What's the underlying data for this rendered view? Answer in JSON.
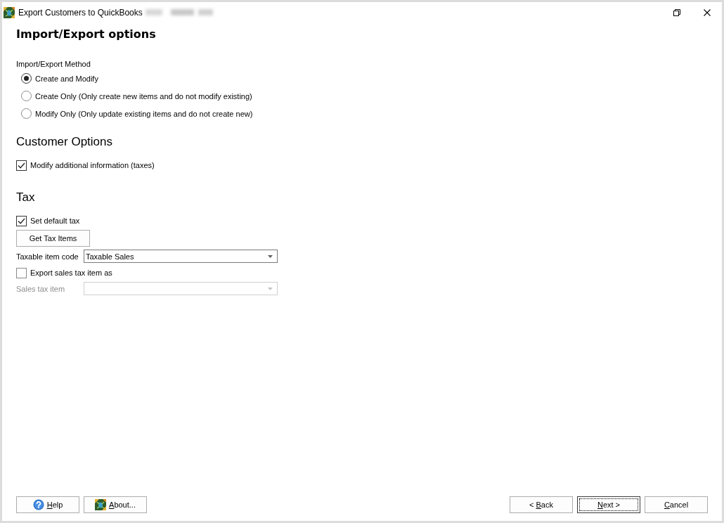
{
  "window": {
    "title": "Export Customers to QuickBooks"
  },
  "page_title": "Import/Export options",
  "method": {
    "label": "Import/Export Method",
    "options": [
      {
        "label": "Create and Modify",
        "selected": true
      },
      {
        "label": "Create Only (Only create new items and do not modify existing)",
        "selected": false
      },
      {
        "label": "Modify Only (Only update existing items and do not create new)",
        "selected": false
      }
    ]
  },
  "customer_options": {
    "heading": "Customer Options",
    "items": [
      {
        "label": "Modify additional information (taxes)",
        "checked": true
      }
    ]
  },
  "tax": {
    "heading": "Tax",
    "rows": [
      {
        "kind": "checkbox",
        "label": "Set default tax",
        "checked": true
      },
      {
        "kind": "button",
        "label": "Get Tax Items"
      },
      {
        "kind": "combo",
        "label": "Taxable item code",
        "value": "Taxable Sales",
        "disabled": false
      },
      {
        "kind": "checkbox",
        "label": "Export sales tax item as",
        "checked": false
      },
      {
        "kind": "combo",
        "label": "Sales tax item",
        "disabled": true
      }
    ]
  },
  "footer": {
    "left_buttons": [
      {
        "kind": "help",
        "label": "Help",
        "focused": false
      },
      {
        "kind": "about",
        "label": "About...",
        "focused": false
      }
    ],
    "right_buttons": [
      {
        "label": "< Back",
        "focused": false
      },
      {
        "label": "Next >",
        "focused": true
      },
      {
        "label": "Cancel",
        "focused": false
      }
    ]
  }
}
